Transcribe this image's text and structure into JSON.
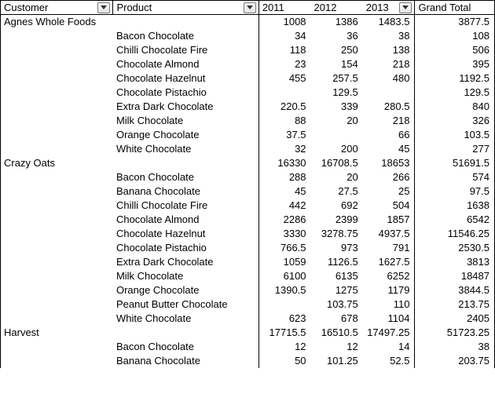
{
  "headers": {
    "customer": "Customer",
    "product": "Product",
    "y2011": "2011",
    "y2012": "2012",
    "y2013": "2013",
    "grand_total": "Grand Total"
  },
  "groups": [
    {
      "customer": "Agnes Whole Foods",
      "subtotal": {
        "y2011": "1008",
        "y2012": "1386",
        "y2013": "1483.5",
        "gt": "3877.5"
      },
      "rows": [
        {
          "product": "Bacon Chocolate",
          "y2011": "34",
          "y2012": "36",
          "y2013": "38",
          "gt": "108"
        },
        {
          "product": "Chilli Chocolate Fire",
          "y2011": "118",
          "y2012": "250",
          "y2013": "138",
          "gt": "506"
        },
        {
          "product": "Chocolate Almond",
          "y2011": "23",
          "y2012": "154",
          "y2013": "218",
          "gt": "395"
        },
        {
          "product": "Chocolate Hazelnut",
          "y2011": "455",
          "y2012": "257.5",
          "y2013": "480",
          "gt": "1192.5"
        },
        {
          "product": "Chocolate Pistachio",
          "y2011": "",
          "y2012": "129.5",
          "y2013": "",
          "gt": "129.5"
        },
        {
          "product": "Extra Dark Chocolate",
          "y2011": "220.5",
          "y2012": "339",
          "y2013": "280.5",
          "gt": "840"
        },
        {
          "product": "Milk Chocolate",
          "y2011": "88",
          "y2012": "20",
          "y2013": "218",
          "gt": "326"
        },
        {
          "product": "Orange Chocolate",
          "y2011": "37.5",
          "y2012": "",
          "y2013": "66",
          "gt": "103.5"
        },
        {
          "product": "White Chocolate",
          "y2011": "32",
          "y2012": "200",
          "y2013": "45",
          "gt": "277"
        }
      ]
    },
    {
      "customer": "Crazy Oats",
      "subtotal": {
        "y2011": "16330",
        "y2012": "16708.5",
        "y2013": "18653",
        "gt": "51691.5"
      },
      "rows": [
        {
          "product": "Bacon Chocolate",
          "y2011": "288",
          "y2012": "20",
          "y2013": "266",
          "gt": "574"
        },
        {
          "product": "Banana Chocolate",
          "y2011": "45",
          "y2012": "27.5",
          "y2013": "25",
          "gt": "97.5"
        },
        {
          "product": "Chilli Chocolate Fire",
          "y2011": "442",
          "y2012": "692",
          "y2013": "504",
          "gt": "1638"
        },
        {
          "product": "Chocolate Almond",
          "y2011": "2286",
          "y2012": "2399",
          "y2013": "1857",
          "gt": "6542"
        },
        {
          "product": "Chocolate Hazelnut",
          "y2011": "3330",
          "y2012": "3278.75",
          "y2013": "4937.5",
          "gt": "11546.25"
        },
        {
          "product": "Chocolate Pistachio",
          "y2011": "766.5",
          "y2012": "973",
          "y2013": "791",
          "gt": "2530.5"
        },
        {
          "product": "Extra Dark Chocolate",
          "y2011": "1059",
          "y2012": "1126.5",
          "y2013": "1627.5",
          "gt": "3813"
        },
        {
          "product": "Milk Chocolate",
          "y2011": "6100",
          "y2012": "6135",
          "y2013": "6252",
          "gt": "18487"
        },
        {
          "product": "Orange Chocolate",
          "y2011": "1390.5",
          "y2012": "1275",
          "y2013": "1179",
          "gt": "3844.5"
        },
        {
          "product": "Peanut Butter Chocolate",
          "y2011": "",
          "y2012": "103.75",
          "y2013": "110",
          "gt": "213.75"
        },
        {
          "product": "White Chocolate",
          "y2011": "623",
          "y2012": "678",
          "y2013": "1104",
          "gt": "2405"
        }
      ]
    },
    {
      "customer": "Harvest",
      "subtotal": {
        "y2011": "17715.5",
        "y2012": "16510.5",
        "y2013": "17497.25",
        "gt": "51723.25"
      },
      "rows": [
        {
          "product": "Bacon Chocolate",
          "y2011": "12",
          "y2012": "12",
          "y2013": "14",
          "gt": "38"
        },
        {
          "product": "Banana Chocolate",
          "y2011": "50",
          "y2012": "101.25",
          "y2013": "52.5",
          "gt": "203.75"
        }
      ]
    }
  ]
}
